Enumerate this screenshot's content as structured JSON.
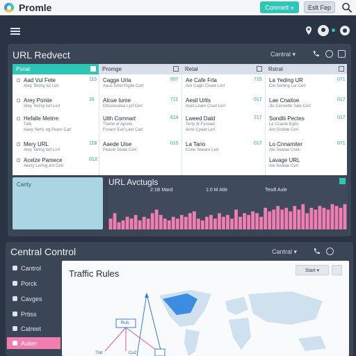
{
  "header": {
    "app_title": "Promle",
    "connect_label": "Conmett »",
    "exit_label": "Eslt Fep"
  },
  "redirect_panel": {
    "title": "URL Redvect",
    "control_label": "Cantral ▾",
    "columns": [
      "Psnal",
      "Promge",
      "Retal",
      "Rstral"
    ],
    "rows": [
      [
        {
          "name": "Aad Vul Fete",
          "sub": "Atey Terrng tut Lorl",
          "num": "115"
        },
        {
          "name": "Cagge Urla",
          "sub": "Aaus fsrlet Pigde Cart",
          "num": "657"
        },
        {
          "name": "Ae Cafe Frla",
          "sub": "Are Caglc Ceare Lerl",
          "num": "715"
        },
        {
          "name": "La Yeding UR",
          "sub": "Cle Serting Lur Cerl",
          "num": "071"
        }
      ],
      [
        {
          "name": "Arey Poniie",
          "sub": "Atey Tering fart Lorl",
          "num": "16"
        },
        {
          "name": "Alcue Iume",
          "sub": "Dbsceoarea Lprl Cerl",
          "num": "711"
        },
        {
          "name": "Aesil Urlts",
          "sub": "Aoet Leare Cvarl Lerl",
          "num": "017"
        },
        {
          "name": "Lae Cnaitoe",
          "sub": "Jle Cersiette Sale Cerl",
          "num": "017"
        }
      ],
      [
        {
          "name": "Hefalle Metrre",
          "sub": "Tafe",
          "num": "",
          "sub2": "Aaey Yertis ng Pvare Carl"
        },
        {
          "name": "Uith Comnart",
          "sub": "Tfame of Aprets",
          "num": "614",
          "sub2": "Fcoare Earl Laet Carl"
        },
        {
          "name": "Lweed Dald",
          "sub": "Terty dr Fyoraet",
          "num": "717",
          "sub2": "Anre Cpaet Lerl"
        },
        {
          "name": "Sondlii Pectes",
          "sub": "Le Ccanle Egtts",
          "num": "017",
          "sub2": "Ant Scrlote Cerl"
        }
      ],
      [
        {
          "name": "Mery URL",
          "sub": "Atey Tering fart Lorl",
          "num": "118"
        },
        {
          "name": "Aaede Uise",
          "sub": "Peacle Seale Cerl",
          "num": "015"
        },
        {
          "name": "La Tario",
          "sub": "Cone Seeare Lerl",
          "num": "017"
        },
        {
          "name": "Lo Cnnamiter",
          "sub": "Ale Seatae Cere",
          "num": "671"
        }
      ],
      [
        {
          "name": "Acelze Pamece",
          "sub": "Aeery Lertng ant Cerl",
          "num": "012"
        },
        {
          "name": "",
          "sub": "",
          "num": ""
        },
        {
          "name": "",
          "sub": "",
          "num": ""
        },
        {
          "name": "Lavage URL",
          "sub": "Ale Seatae Cerl",
          "num": ""
        }
      ]
    ],
    "calendar_label": "Carity",
    "chart": {
      "title": "URL Avctugls",
      "legend": [
        "2:1B Mard",
        "1:0 M Atle",
        "Tesdl Aule"
      ]
    }
  },
  "central_panel": {
    "title": "Central Control",
    "control_label": "Cantral ▾",
    "sidebar": [
      "Cantrol",
      "Porck",
      "Cavges",
      "Prtiss",
      "Calreet",
      "Aulen"
    ],
    "active_index": 5,
    "main_title": "Traffic Rules",
    "start_label": "Start ▾",
    "node_label": "Ruls",
    "node_labels_bottom": [
      "Tnd",
      "Cu2"
    ]
  },
  "chart_data": {
    "type": "bar",
    "title": "URL Avctugls",
    "legend": [
      "2:1B Mard",
      "1:0 M Atle",
      "Tesdl Aule"
    ],
    "values": [
      30,
      45,
      20,
      25,
      35,
      30,
      40,
      25,
      35,
      30,
      45,
      55,
      40,
      30,
      25,
      35,
      30,
      40,
      35,
      45,
      50,
      30,
      25,
      35,
      40,
      30,
      45,
      35,
      40,
      30,
      55,
      35,
      45,
      40,
      50,
      45,
      35,
      60,
      50,
      55,
      65,
      55,
      60,
      50,
      65,
      55,
      70,
      45,
      60,
      55,
      65,
      60,
      55,
      70,
      65,
      60,
      70
    ],
    "ylim": [
      0,
      100
    ],
    "color": "#f07eb0"
  },
  "colors": {
    "accent": "#2ec6b6",
    "active": "#f07eb0",
    "panel": "#3a4556",
    "background": "#2b3444"
  }
}
